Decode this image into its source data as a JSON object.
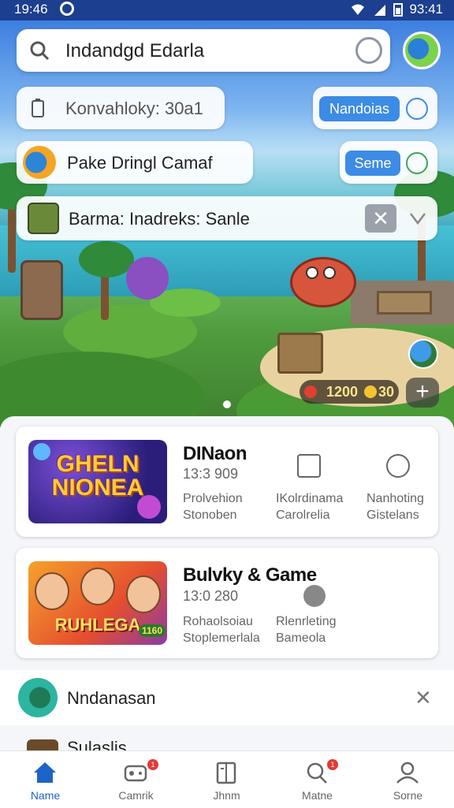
{
  "status_bar": {
    "time": "19:46",
    "battery": "93:41"
  },
  "search": {
    "query": "Indandgd Edarla"
  },
  "rows": [
    {
      "text": "Konvahloky: 30a1",
      "button": "Nandoias"
    },
    {
      "text": "Pake Dringl Camaf",
      "button": "Seme"
    },
    {
      "text": "Barma: Inadreks: Sanle"
    }
  ],
  "hero": {
    "score": "1200",
    "coins": "30"
  },
  "cards": [
    {
      "thumb_text": "GHELN NIONEA",
      "title": "DINaon",
      "subtitle": "13:3 909",
      "meta_left": [
        "Prolvehion",
        "Stonoben"
      ],
      "meta_mid": [
        "IKolrdinama",
        "Carolrelia"
      ],
      "meta_right": [
        "Nanhoting",
        "Gistelans"
      ]
    },
    {
      "thumb_text": "RUHLEGA",
      "thumb_badge": "1160",
      "title": "Bulvky & Game",
      "subtitle": "13:0 280",
      "meta_left": [
        "Rohaolsoiau",
        "Stoplemerlala"
      ],
      "meta_mid": [
        "Rlenrleting",
        "Bameola"
      ]
    }
  ],
  "notification": {
    "text": "Nndanasan",
    "next_text": "Sulaslis"
  },
  "nav": [
    {
      "label": "Name",
      "icon": "home-icon",
      "active": true
    },
    {
      "label": "Camrik",
      "icon": "gamepad-icon",
      "badge": "1"
    },
    {
      "label": "Jhnm",
      "icon": "library-icon"
    },
    {
      "label": "Matne",
      "icon": "search-icon",
      "badge": "1"
    },
    {
      "label": "Sorne",
      "icon": "profile-icon"
    }
  ],
  "colors": {
    "accent": "#3c8be4",
    "status_bar": "#1c3f8f",
    "nav_active": "#1e63c9"
  }
}
